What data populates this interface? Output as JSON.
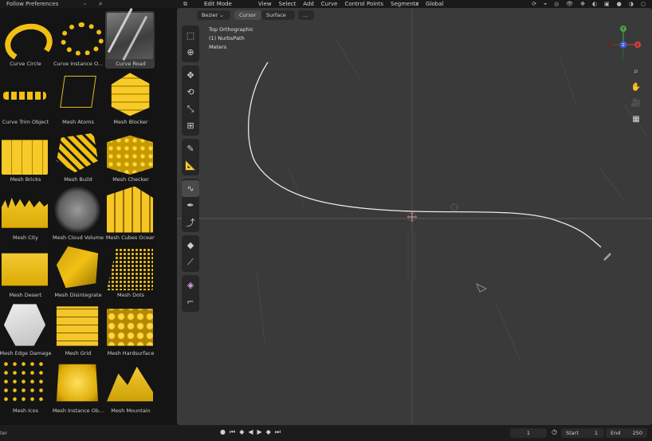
{
  "topbar": {
    "preferences_label": "Follow Preferences",
    "mode": "Edit Mode",
    "menu": [
      "View",
      "Select",
      "Add",
      "Curve",
      "Control Points",
      "Segments"
    ],
    "transform_orientation": "Global"
  },
  "assets": [
    {
      "label": "Curve Circle",
      "art": "ring"
    },
    {
      "label": "Curve Instance O...",
      "art": "dots-ring"
    },
    {
      "label": "Curve Road",
      "art": "road"
    },
    {
      "label": "Curve Trim Object",
      "art": "trim"
    },
    {
      "label": "Mesh Atoms",
      "art": "atoms"
    },
    {
      "label": "Mesh Blocker",
      "art": "blocker"
    },
    {
      "label": "Mesh Bricks",
      "art": "bricks"
    },
    {
      "label": "Mesh Build",
      "art": "build"
    },
    {
      "label": "Mesh Checker",
      "art": "checker"
    },
    {
      "label": "Mesh City",
      "art": "city"
    },
    {
      "label": "Mesh Cloud Volume",
      "art": "cloud"
    },
    {
      "label": "Mesh Cubes Ocean",
      "art": "cubes-ocean"
    },
    {
      "label": "Mesh Desert",
      "art": "desert"
    },
    {
      "label": "Mesh Disintegrate",
      "art": "disint"
    },
    {
      "label": "Mesh Dots",
      "art": "mdots"
    },
    {
      "label": "Mesh Edge Damage",
      "art": "edge"
    },
    {
      "label": "Mesh Grid",
      "art": "mgrid"
    },
    {
      "label": "Mesh Hardsurface",
      "art": "hard"
    },
    {
      "label": "Mesh Icos",
      "art": "icos"
    },
    {
      "label": "Mesh Instance Ob...",
      "art": "inst"
    },
    {
      "label": "Mesh Mountain",
      "art": "mountain"
    }
  ],
  "selected_asset": "Curve Road",
  "viewport": {
    "header": {
      "curve_type": "Bezier",
      "cursor": "Cursor",
      "surface": "Surface"
    },
    "info": {
      "view": "Top Orthographic",
      "object": "(1) NurbsPath",
      "units": "Meters"
    },
    "gizmo_axes": {
      "x": "X",
      "y": "Y",
      "z": "Z"
    }
  },
  "timeline": {
    "left_text": "ter",
    "current_frame": "1",
    "start_label": "Start",
    "start": "1",
    "end_label": "End",
    "end": "250"
  }
}
